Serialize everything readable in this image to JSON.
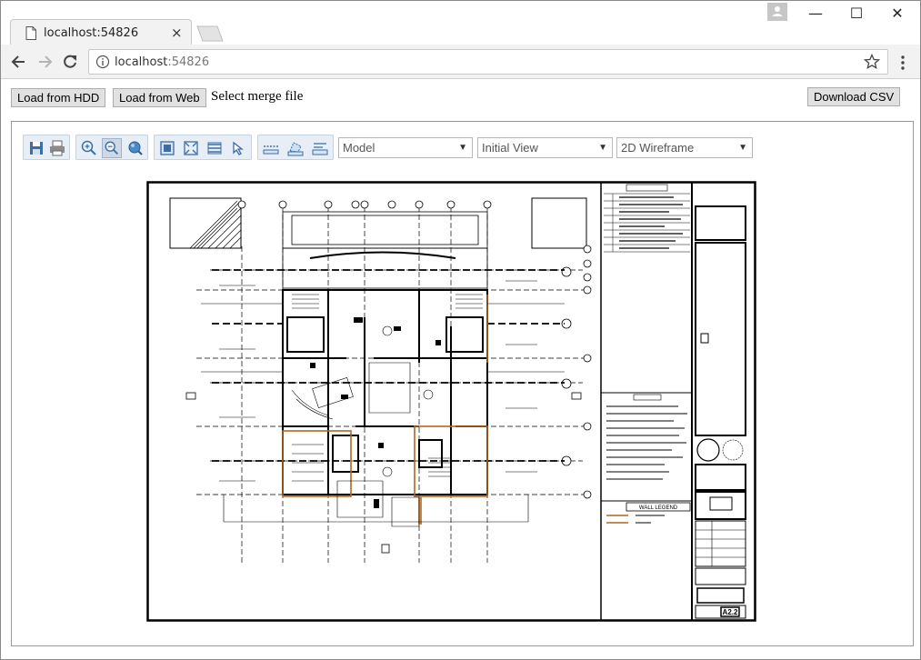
{
  "browser": {
    "tab_title": "localhost:54826",
    "tab_close": "×",
    "url_host": "localhost",
    "url_port": ":54826",
    "minimize": "—",
    "maximize": "☐",
    "close": "✕"
  },
  "page": {
    "load_hdd": "Load from HDD",
    "load_web": "Load from Web",
    "merge_label": "Select merge file",
    "download_csv": "Download CSV"
  },
  "viewer": {
    "tools": [
      "save-icon",
      "print-icon",
      "zoom-in-icon",
      "zoom-out-icon",
      "zoom-3d-icon",
      "zoom-window-icon",
      "zoom-extents-icon",
      "layers-icon",
      "select-icon",
      "measure-distance-icon",
      "measure-area-icon",
      "measure-angle-icon"
    ],
    "space_select": {
      "value": "Model"
    },
    "view_select": {
      "value": "Initial View"
    },
    "style_select": {
      "value": "2D Wireframe"
    }
  },
  "drawing": {
    "legend_title": "WALL LEGEND",
    "sheet_number": "A2.2"
  },
  "colors": {
    "accent": "#3a6ea5",
    "drawing_line": "#000000",
    "wall_orange": "#b5651d"
  }
}
